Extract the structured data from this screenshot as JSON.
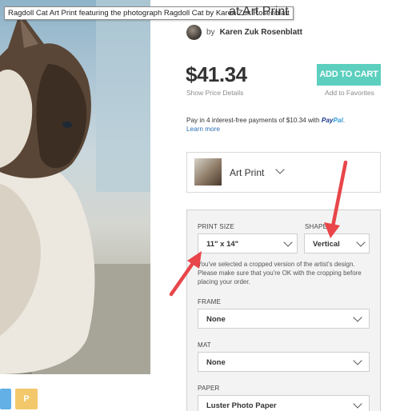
{
  "tooltip": "Ragdoll Cat Art Print featuring the photograph Ragdoll Cat by Karen Zuk Rosenblatt",
  "title": "at Art Print",
  "artist": {
    "prefix": "by",
    "name": "Karen Zuk Rosenblatt"
  },
  "price": "$41.34",
  "price_details": "Show Price Details",
  "add_to_cart": "ADD TO CART",
  "add_to_favorites": "Add to Favorites",
  "paypal": {
    "text": "Pay in 4 interest-free payments of $10.34 with",
    "logo_a": "Pay",
    "logo_b": "Pal",
    "period": ".",
    "learn_more": "Learn more"
  },
  "product": {
    "label": "Art Print"
  },
  "options": {
    "print_size": {
      "label": "PRINT SIZE",
      "value": "11\" x 14\""
    },
    "shape": {
      "label": "SHAPE",
      "value": "Vertical"
    },
    "note": "You've selected a cropped version of the artist's design. Please make sure that you're OK with the cropping before placing your order.",
    "frame": {
      "label": "FRAME",
      "value": "None"
    },
    "mat": {
      "label": "MAT",
      "value": "None"
    },
    "paper": {
      "label": "PAPER",
      "value": "Luster Photo Paper"
    }
  },
  "share": {
    "pinterest_glyph": "P"
  },
  "colors": {
    "accent": "#5ccfbf",
    "arrow": "#e8464a",
    "link": "#2a6fb3"
  }
}
